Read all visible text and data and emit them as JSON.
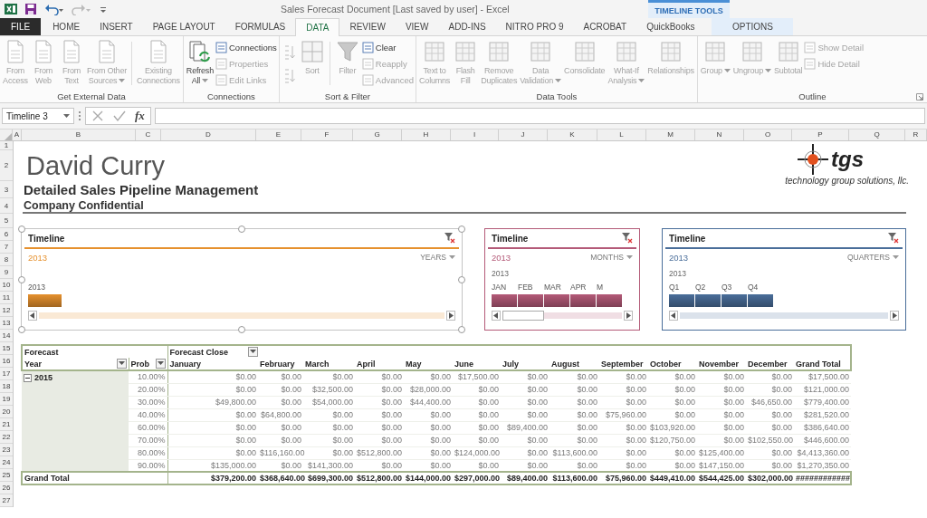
{
  "window": {
    "title": "Sales Forecast Document [Last saved by user] - Excel",
    "contextual_group": "TIMELINE TOOLS"
  },
  "ribbon_tabs": [
    {
      "label": "FILE",
      "kind": "file",
      "selected": false
    },
    {
      "label": "HOME",
      "kind": "normal",
      "selected": false
    },
    {
      "label": "INSERT",
      "kind": "normal",
      "selected": false
    },
    {
      "label": "PAGE LAYOUT",
      "kind": "normal",
      "selected": false
    },
    {
      "label": "FORMULAS",
      "kind": "normal",
      "selected": false
    },
    {
      "label": "DATA",
      "kind": "normal",
      "selected": true
    },
    {
      "label": "REVIEW",
      "kind": "normal",
      "selected": false
    },
    {
      "label": "VIEW",
      "kind": "normal",
      "selected": false
    },
    {
      "label": "ADD-INS",
      "kind": "normal",
      "selected": false
    },
    {
      "label": "NITRO PRO 9",
      "kind": "normal",
      "selected": false
    },
    {
      "label": "ACROBAT",
      "kind": "normal",
      "selected": false
    },
    {
      "label": "QuickBooks",
      "kind": "normal",
      "selected": false
    },
    {
      "label": "OPTIONS",
      "kind": "contextual",
      "selected": false
    }
  ],
  "ribbon_groups": [
    {
      "label": "Get External Data",
      "items": [
        {
          "kind": "large",
          "label": "From\nAccess",
          "disabled": true
        },
        {
          "kind": "large",
          "label": "From\nWeb",
          "disabled": true
        },
        {
          "kind": "large",
          "label": "From\nText",
          "disabled": true
        },
        {
          "kind": "large",
          "label": "From Other\nSources",
          "disabled": true,
          "dropdown": true
        },
        {
          "kind": "large",
          "label": "Existing\nConnections",
          "disabled": true,
          "divider_before": true
        }
      ]
    },
    {
      "label": "Connections",
      "items": [
        {
          "kind": "large",
          "label": "Refresh\nAll",
          "disabled": false,
          "dropdown": true
        },
        {
          "kind": "stack",
          "items": [
            {
              "label": "Connections",
              "disabled": false
            },
            {
              "label": "Properties",
              "disabled": true
            },
            {
              "label": "Edit Links",
              "disabled": true
            }
          ]
        }
      ]
    },
    {
      "label": "Sort & Filter",
      "items": [
        {
          "kind": "sort_pair",
          "disabled": true
        },
        {
          "kind": "large",
          "label": "Sort",
          "disabled": true
        },
        {
          "kind": "large",
          "label": "Filter",
          "disabled": true,
          "divider_before": true
        },
        {
          "kind": "stack",
          "items": [
            {
              "label": "Clear",
              "disabled": false
            },
            {
              "label": "Reapply",
              "disabled": true
            },
            {
              "label": "Advanced",
              "disabled": true
            }
          ]
        }
      ]
    },
    {
      "label": "Data Tools",
      "items": [
        {
          "kind": "large",
          "label": "Text to\nColumns",
          "disabled": true
        },
        {
          "kind": "large",
          "label": "Flash\nFill",
          "disabled": true
        },
        {
          "kind": "large",
          "label": "Remove\nDuplicates",
          "disabled": true
        },
        {
          "kind": "large",
          "label": "Data\nValidation",
          "disabled": true,
          "dropdown": true
        },
        {
          "kind": "large",
          "label": "Consolidate",
          "disabled": true
        },
        {
          "kind": "large",
          "label": "What-If\nAnalysis",
          "disabled": true,
          "dropdown": true
        },
        {
          "kind": "large",
          "label": "Relationships",
          "disabled": true
        }
      ]
    },
    {
      "label": "Outline",
      "launcher": true,
      "items": [
        {
          "kind": "large",
          "label": "Group",
          "disabled": true,
          "dropdown": true
        },
        {
          "kind": "large",
          "label": "Ungroup",
          "disabled": true,
          "dropdown": true
        },
        {
          "kind": "large",
          "label": "Subtotal",
          "disabled": true
        },
        {
          "kind": "stack",
          "items": [
            {
              "label": "Show Detail",
              "disabled": true
            },
            {
              "label": "Hide Detail",
              "disabled": true
            }
          ]
        }
      ]
    }
  ],
  "formula_bar": {
    "name_box": "Timeline 3",
    "function_label": "fx"
  },
  "column_headers": [
    "A",
    "B",
    "C",
    "D",
    "E",
    "F",
    "G",
    "H",
    "I",
    "J",
    "K",
    "L",
    "M",
    "N",
    "O",
    "P",
    "Q",
    "R"
  ],
  "row_headers": [
    "1",
    "2",
    "3",
    "4",
    "5",
    "6",
    "7",
    "8",
    "9",
    "10",
    "11",
    "12",
    "13",
    "14",
    "15",
    "16",
    "17",
    "18",
    "19",
    "20",
    "21",
    "22",
    "23",
    "24",
    "25",
    "26",
    "27"
  ],
  "sheet": {
    "title": "David Curry",
    "subtitle": "Detailed Sales Pipeline Management",
    "note": "Company Confidential",
    "logo": {
      "name": "tgs",
      "tagline": "technology group solutions, llc."
    }
  },
  "timelines": [
    {
      "title": "Timeline",
      "selection": "2013",
      "level": "YEARS",
      "units": [
        "2013"
      ],
      "color": "#e6912e",
      "selected": true
    },
    {
      "title": "Timeline",
      "selection": "2013",
      "level": "MONTHS",
      "period": "2013",
      "units": [
        "JAN",
        "FEB",
        "MAR",
        "APR",
        "M"
      ],
      "color": "#b45a78",
      "selected": false
    },
    {
      "title": "Timeline",
      "selection": "2013",
      "level": "QUARTERS",
      "period": "2013",
      "units": [
        "Q1",
        "Q2",
        "Q3",
        "Q4"
      ],
      "color": "#4a6e9a",
      "selected": false
    }
  ],
  "pivot": {
    "header": "Forecast",
    "column_field": "Forecast Close",
    "row_fields": [
      "Year",
      "Prob"
    ],
    "columns": [
      "January",
      "February",
      "March",
      "April",
      "May",
      "June",
      "July",
      "August",
      "September",
      "October",
      "November",
      "December",
      "Grand Total"
    ],
    "groups": [
      {
        "label": "2015",
        "expanded": true,
        "rows": [
          {
            "label": "10.00%",
            "values": [
              "$0.00",
              "$0.00",
              "$0.00",
              "$0.00",
              "$0.00",
              "$17,500.00",
              "$0.00",
              "$0.00",
              "$0.00",
              "$0.00",
              "$0.00",
              "$0.00",
              "$17,500.00"
            ]
          },
          {
            "label": "20.00%",
            "values": [
              "$0.00",
              "$0.00",
              "$32,500.00",
              "$0.00",
              "$28,000.00",
              "$0.00",
              "$0.00",
              "$0.00",
              "$0.00",
              "$0.00",
              "$0.00",
              "$0.00",
              "$121,000.00"
            ]
          },
          {
            "label": "30.00%",
            "values": [
              "$49,800.00",
              "$0.00",
              "$54,000.00",
              "$0.00",
              "$44,400.00",
              "$0.00",
              "$0.00",
              "$0.00",
              "$0.00",
              "$0.00",
              "$0.00",
              "$46,650.00",
              "$779,400.00"
            ]
          },
          {
            "label": "40.00%",
            "values": [
              "$0.00",
              "$64,800.00",
              "$0.00",
              "$0.00",
              "$0.00",
              "$0.00",
              "$0.00",
              "$0.00",
              "$75,960.00",
              "$0.00",
              "$0.00",
              "$0.00",
              "$281,520.00"
            ]
          },
          {
            "label": "60.00%",
            "values": [
              "$0.00",
              "$0.00",
              "$0.00",
              "$0.00",
              "$0.00",
              "$0.00",
              "$89,400.00",
              "$0.00",
              "$0.00",
              "$103,920.00",
              "$0.00",
              "$0.00",
              "$386,640.00"
            ]
          },
          {
            "label": "70.00%",
            "values": [
              "$0.00",
              "$0.00",
              "$0.00",
              "$0.00",
              "$0.00",
              "$0.00",
              "$0.00",
              "$0.00",
              "$0.00",
              "$120,750.00",
              "$0.00",
              "$102,550.00",
              "$446,600.00"
            ]
          },
          {
            "label": "80.00%",
            "values": [
              "$0.00",
              "$116,160.00",
              "$0.00",
              "$512,800.00",
              "$0.00",
              "$124,000.00",
              "$0.00",
              "$113,600.00",
              "$0.00",
              "$0.00",
              "$125,400.00",
              "$0.00",
              "$4,413,360.00"
            ]
          },
          {
            "label": "90.00%",
            "values": [
              "$135,000.00",
              "$0.00",
              "$141,300.00",
              "$0.00",
              "$0.00",
              "$0.00",
              "$0.00",
              "$0.00",
              "$0.00",
              "$0.00",
              "$147,150.00",
              "$0.00",
              "$1,270,350.00"
            ]
          }
        ]
      }
    ],
    "grand_total": {
      "label": "Grand Total",
      "values": [
        "$379,200.00",
        "$368,640.00",
        "$699,300.00",
        "$512,800.00",
        "$144,000.00",
        "$297,000.00",
        "$89,400.00",
        "$113,600.00",
        "$75,960.00",
        "$449,410.00",
        "$544,425.00",
        "$302,000.00",
        "############"
      ]
    }
  }
}
